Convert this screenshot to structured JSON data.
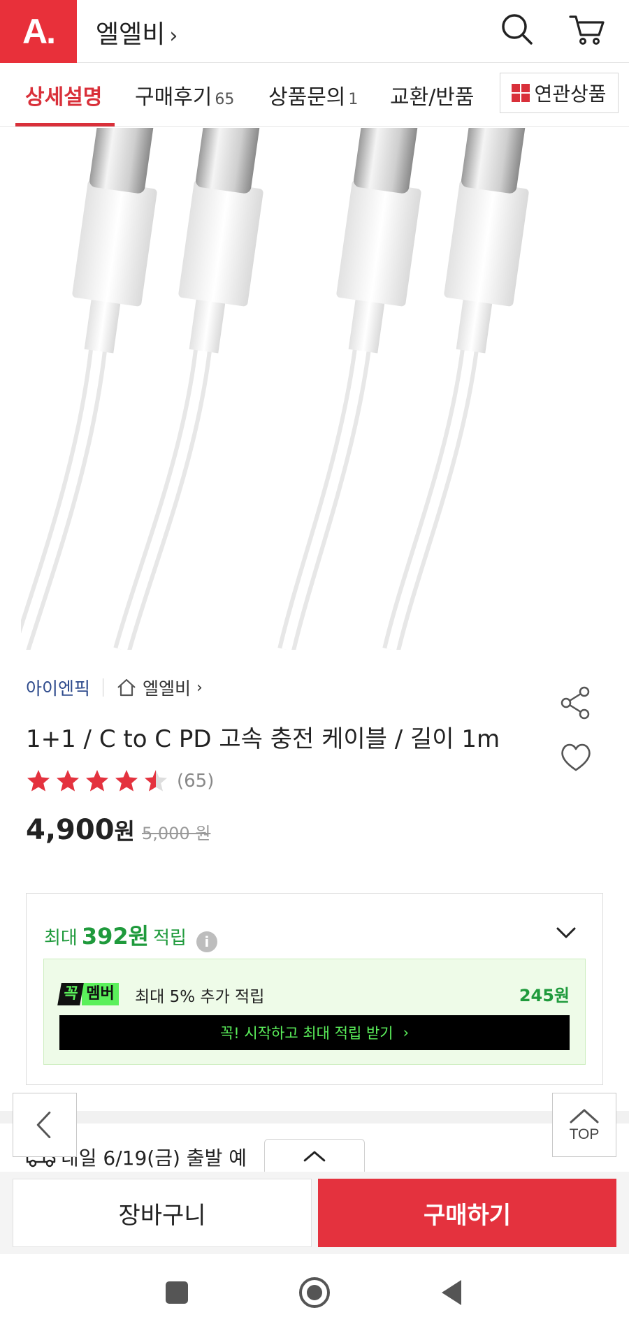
{
  "header": {
    "logo_text": "A.",
    "store_name": "엘엘비",
    "store_chevron": "›",
    "search_icon": "search-icon",
    "cart_icon": "cart-icon",
    "brand_color": "#e8303a"
  },
  "tabs": [
    {
      "label": "상세설명",
      "count": "",
      "active": true
    },
    {
      "label": "구매후기",
      "count": "65",
      "active": false
    },
    {
      "label": "상품문의",
      "count": "1",
      "active": false
    },
    {
      "label": "교환/반품",
      "count": "",
      "active": false
    }
  ],
  "related_button": {
    "label": "연관상품",
    "icon": "grid-icon"
  },
  "product": {
    "brand": "아이엔픽",
    "store": "엘엘비",
    "store_chevron": "›",
    "title": "1+1 / C to C PD 고속 충전 케이블 / 길이 1m",
    "rating": 4.5,
    "rating_max": 5,
    "review_count": "(65)",
    "price": "4,900",
    "price_unit": "원",
    "original_price": "5,000 원",
    "star_color": "#e4323e"
  },
  "points": {
    "prefix": "최대",
    "amount": "392원",
    "suffix": "적립",
    "info_icon": "i",
    "member": {
      "badge_left": "꼭",
      "badge_right": "멤버",
      "text": "최대 5% 추가 적립",
      "amount": "245원",
      "cta": "꼭! 시작하고 최대 적립 받기",
      "cta_chevron": "›"
    },
    "accent_color": "#1f9a3c"
  },
  "shipping": {
    "text": "내일 6/19(금) 출발 예"
  },
  "floating": {
    "top_label": "TOP"
  },
  "actions": {
    "cart_label": "장바구니",
    "buy_label": "구매하기",
    "buy_color": "#e4323e"
  }
}
